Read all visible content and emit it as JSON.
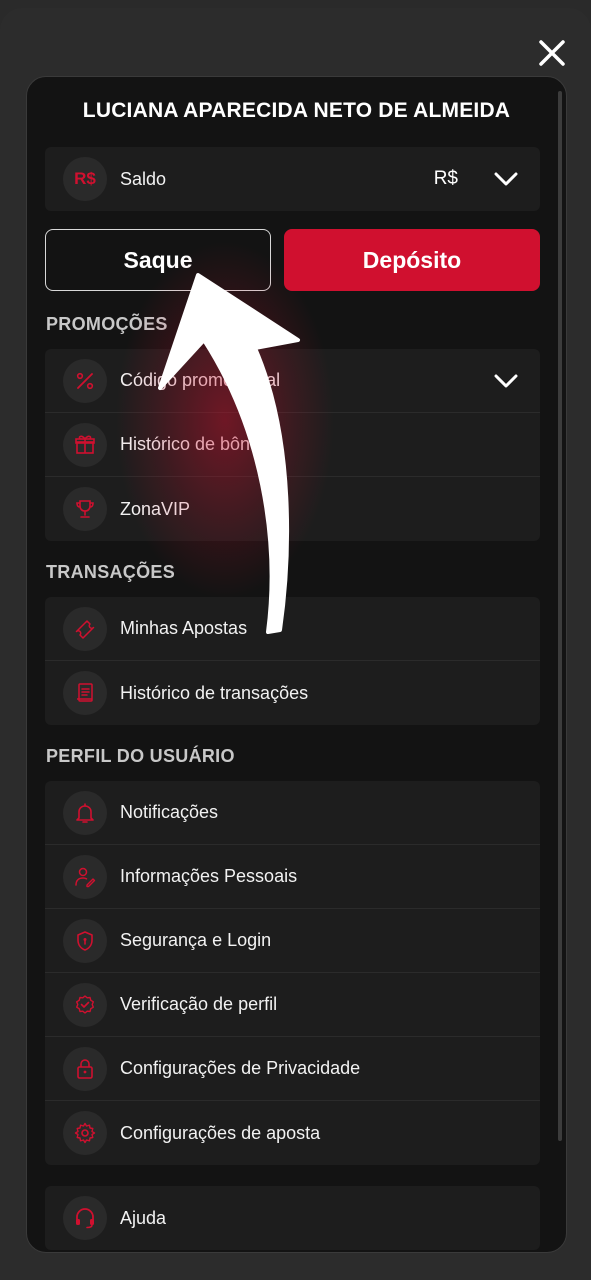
{
  "user": {
    "name": "LUCIANA APARECIDA NETO DE ALMEIDA"
  },
  "balance": {
    "currency_icon": "R$",
    "label": "Saldo",
    "value": "R$"
  },
  "buttons": {
    "withdraw": "Saque",
    "deposit": "Depósito"
  },
  "sections": {
    "promotions": {
      "title": "PROMOÇÕES",
      "items": [
        {
          "label": "Código promocional",
          "icon": "percent-icon"
        },
        {
          "label": "Histórico de bônus",
          "icon": "gift-icon"
        },
        {
          "label": "ZonaVIP",
          "icon": "trophy-icon"
        }
      ]
    },
    "transactions": {
      "title": "TRANSAÇÕES",
      "items": [
        {
          "label": "Minhas Apostas",
          "icon": "ticket-icon"
        },
        {
          "label": "Histórico de transações",
          "icon": "receipt-icon"
        }
      ]
    },
    "profile": {
      "title": "PERFIL DO USUÁRIO",
      "items": [
        {
          "label": "Notificações",
          "icon": "bell-icon"
        },
        {
          "label": "Informações Pessoais",
          "icon": "user-edit-icon"
        },
        {
          "label": "Segurança e Login",
          "icon": "shield-icon"
        },
        {
          "label": "Verificação de perfil",
          "icon": "badge-check-icon"
        },
        {
          "label": "Configurações de Privacidade",
          "icon": "lock-icon"
        },
        {
          "label": "Configurações de aposta",
          "icon": "gear-icon"
        }
      ]
    },
    "help": {
      "items": [
        {
          "label": "Ajuda",
          "icon": "headset-icon"
        }
      ]
    }
  },
  "colors": {
    "accent": "#d0102f",
    "panel": "#131313",
    "card": "#1d1d1d"
  }
}
